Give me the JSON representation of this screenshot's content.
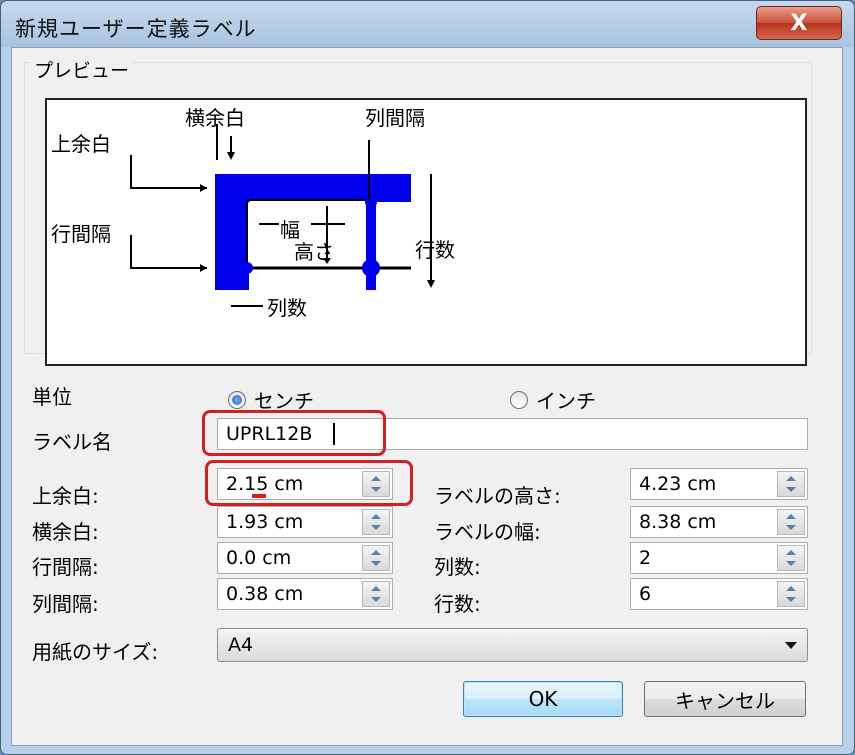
{
  "window": {
    "title": "新規ユーザー定義ラベル",
    "close_glyph": "X"
  },
  "preview": {
    "group_title": "プレビュー",
    "labels": {
      "top_margin": "上余白",
      "side_margin": "横余白",
      "column_gap": "列間隔",
      "row_gap": "行間隔",
      "width": "幅",
      "height": "高さ",
      "rows": "行数",
      "columns": "列数"
    },
    "shape_color": "#0000ee"
  },
  "units": {
    "label": "単位",
    "options": [
      {
        "label": "センチ",
        "selected": true
      },
      {
        "label": "インチ",
        "selected": false
      }
    ]
  },
  "label_name": {
    "label": "ラベル名",
    "value": "UPRL12B"
  },
  "fields_left": [
    {
      "label": "上余白:",
      "value": "2.15 cm"
    },
    {
      "label": "横余白:",
      "value": "1.93 cm"
    },
    {
      "label": "行間隔:",
      "value": "0.0 cm"
    },
    {
      "label": "列間隔:",
      "value": "0.38 cm"
    }
  ],
  "fields_right": [
    {
      "label": "ラベルの高さ:",
      "value": "4.23 cm"
    },
    {
      "label": "ラベルの幅:",
      "value": "8.38 cm"
    },
    {
      "label": "列数:",
      "value": "2"
    },
    {
      "label": "行数:",
      "value": "6"
    }
  ],
  "paper_size": {
    "label": "用紙のサイズ:",
    "value": "A4"
  },
  "buttons": {
    "ok": "OK",
    "cancel": "キャンセル"
  },
  "highlight_color": "#d21f1f"
}
